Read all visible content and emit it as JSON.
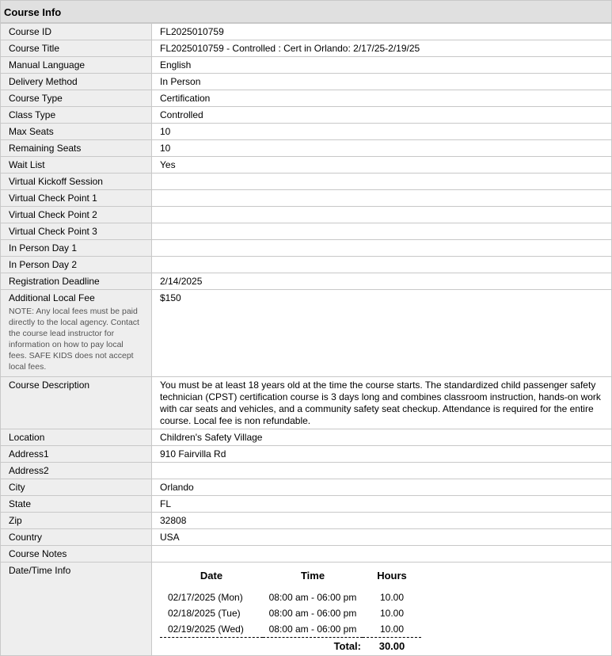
{
  "section_title": "Course Info",
  "rows": [
    {
      "label": "Course ID",
      "value": "FL2025010759"
    },
    {
      "label": "Course Title",
      "value": "FL2025010759 - Controlled : Cert in Orlando: 2/17/25-2/19/25"
    },
    {
      "label": "Manual Language",
      "value": "English"
    },
    {
      "label": "Delivery Method",
      "value": "In Person"
    },
    {
      "label": "Course Type",
      "value": "Certification"
    },
    {
      "label": "Class Type",
      "value": "Controlled"
    },
    {
      "label": "Max Seats",
      "value": "10"
    },
    {
      "label": "Remaining Seats",
      "value": "10"
    },
    {
      "label": "Wait List",
      "value": "Yes"
    },
    {
      "label": "Virtual Kickoff Session",
      "value": ""
    },
    {
      "label": "Virtual Check Point 1",
      "value": ""
    },
    {
      "label": "Virtual Check Point 2",
      "value": ""
    },
    {
      "label": "Virtual Check Point 3",
      "value": ""
    },
    {
      "label": "In Person Day 1",
      "value": ""
    },
    {
      "label": "In Person Day 2",
      "value": ""
    },
    {
      "label": "Registration Deadline",
      "value": "2/14/2025"
    }
  ],
  "fee": {
    "label": "Additional Local Fee",
    "note": "NOTE: Any local fees must be paid directly to the local agency. Contact the course lead instructor for information on how to pay local fees. SAFE KIDS does not accept local fees.",
    "value": "$150"
  },
  "description": {
    "label": "Course Description",
    "value": "You must be at least 18 years old at the time the course starts. The standardized child passenger safety technician (CPST) certification course is 3 days long and combines classroom instruction, hands-on work with car seats and vehicles, and a community safety seat checkup. Attendance is required for the entire course. Local fee is non refundable."
  },
  "location_rows": [
    {
      "label": "Location",
      "value": "Children's Safety Village"
    },
    {
      "label": "Address1",
      "value": "910 Fairvilla Rd"
    },
    {
      "label": "Address2",
      "value": ""
    },
    {
      "label": "City",
      "value": "Orlando"
    },
    {
      "label": "State",
      "value": "FL"
    },
    {
      "label": "Zip",
      "value": "32808"
    },
    {
      "label": "Country",
      "value": "USA"
    },
    {
      "label": "Course Notes",
      "value": ""
    }
  ],
  "datetime": {
    "label": "Date/Time Info",
    "headers": {
      "date": "Date",
      "time": "Time",
      "hours": "Hours"
    },
    "sessions": [
      {
        "date": "02/17/2025 (Mon)",
        "time": "08:00 am - 06:00 pm",
        "hours": "10.00"
      },
      {
        "date": "02/18/2025 (Tue)",
        "time": "08:00 am - 06:00 pm",
        "hours": "10.00"
      },
      {
        "date": "02/19/2025 (Wed)",
        "time": "08:00 am - 06:00 pm",
        "hours": "10.00"
      }
    ],
    "total_label": "Total:",
    "total_value": "30.00"
  }
}
